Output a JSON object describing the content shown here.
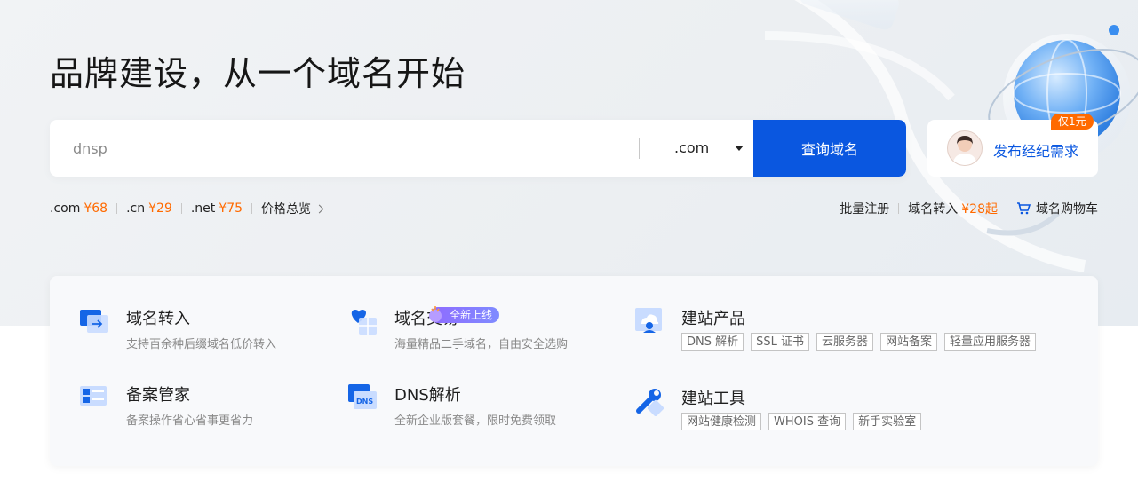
{
  "hero": {
    "headline": "品牌建设，从一个域名开始"
  },
  "search": {
    "value": "",
    "placeholder": "dnsp",
    "tld_selected": ".com",
    "button_label": "查询域名"
  },
  "broker": {
    "label": "发布经纪需求",
    "badge": "仅1元"
  },
  "prices": [
    {
      "tld": ".com",
      "price": "¥68"
    },
    {
      "tld": ".cn",
      "price": "¥29"
    },
    {
      "tld": ".net",
      "price": "¥75"
    }
  ],
  "price_overview": "价格总览",
  "right_links": {
    "bulk": "批量注册",
    "transfer": "域名转入",
    "transfer_price": "¥28起",
    "cart": "域名购物车"
  },
  "services": [
    {
      "icon": "domain-transfer-icon",
      "title": "域名转入",
      "desc": "支持百余种后缀域名低价转入"
    },
    {
      "icon": "domain-trade-icon",
      "title": "域名交易",
      "new_tag": "全新上线",
      "desc": "海量精品二手域名，自由安全选购"
    },
    {
      "icon": "site-product-icon",
      "title": "建站产品",
      "tags": [
        "DNS 解析",
        "SSL 证书",
        "云服务器",
        "网站备案",
        "轻量应用服务器"
      ]
    },
    {
      "icon": "icp-filing-icon",
      "title": "备案管家",
      "desc": "备案操作省心省事更省力"
    },
    {
      "icon": "dns-icon",
      "title": "DNS解析",
      "desc": "全新企业版套餐，限时免费领取"
    },
    {
      "icon": "site-tools-icon",
      "title": "建站工具",
      "tags": [
        "网站健康检测",
        "WHOIS 查询",
        "新手实验室"
      ]
    }
  ],
  "colors": {
    "primary": "#0a57e0",
    "accent_orange": "#ff6a00",
    "new_tag": "#8f6bff"
  }
}
